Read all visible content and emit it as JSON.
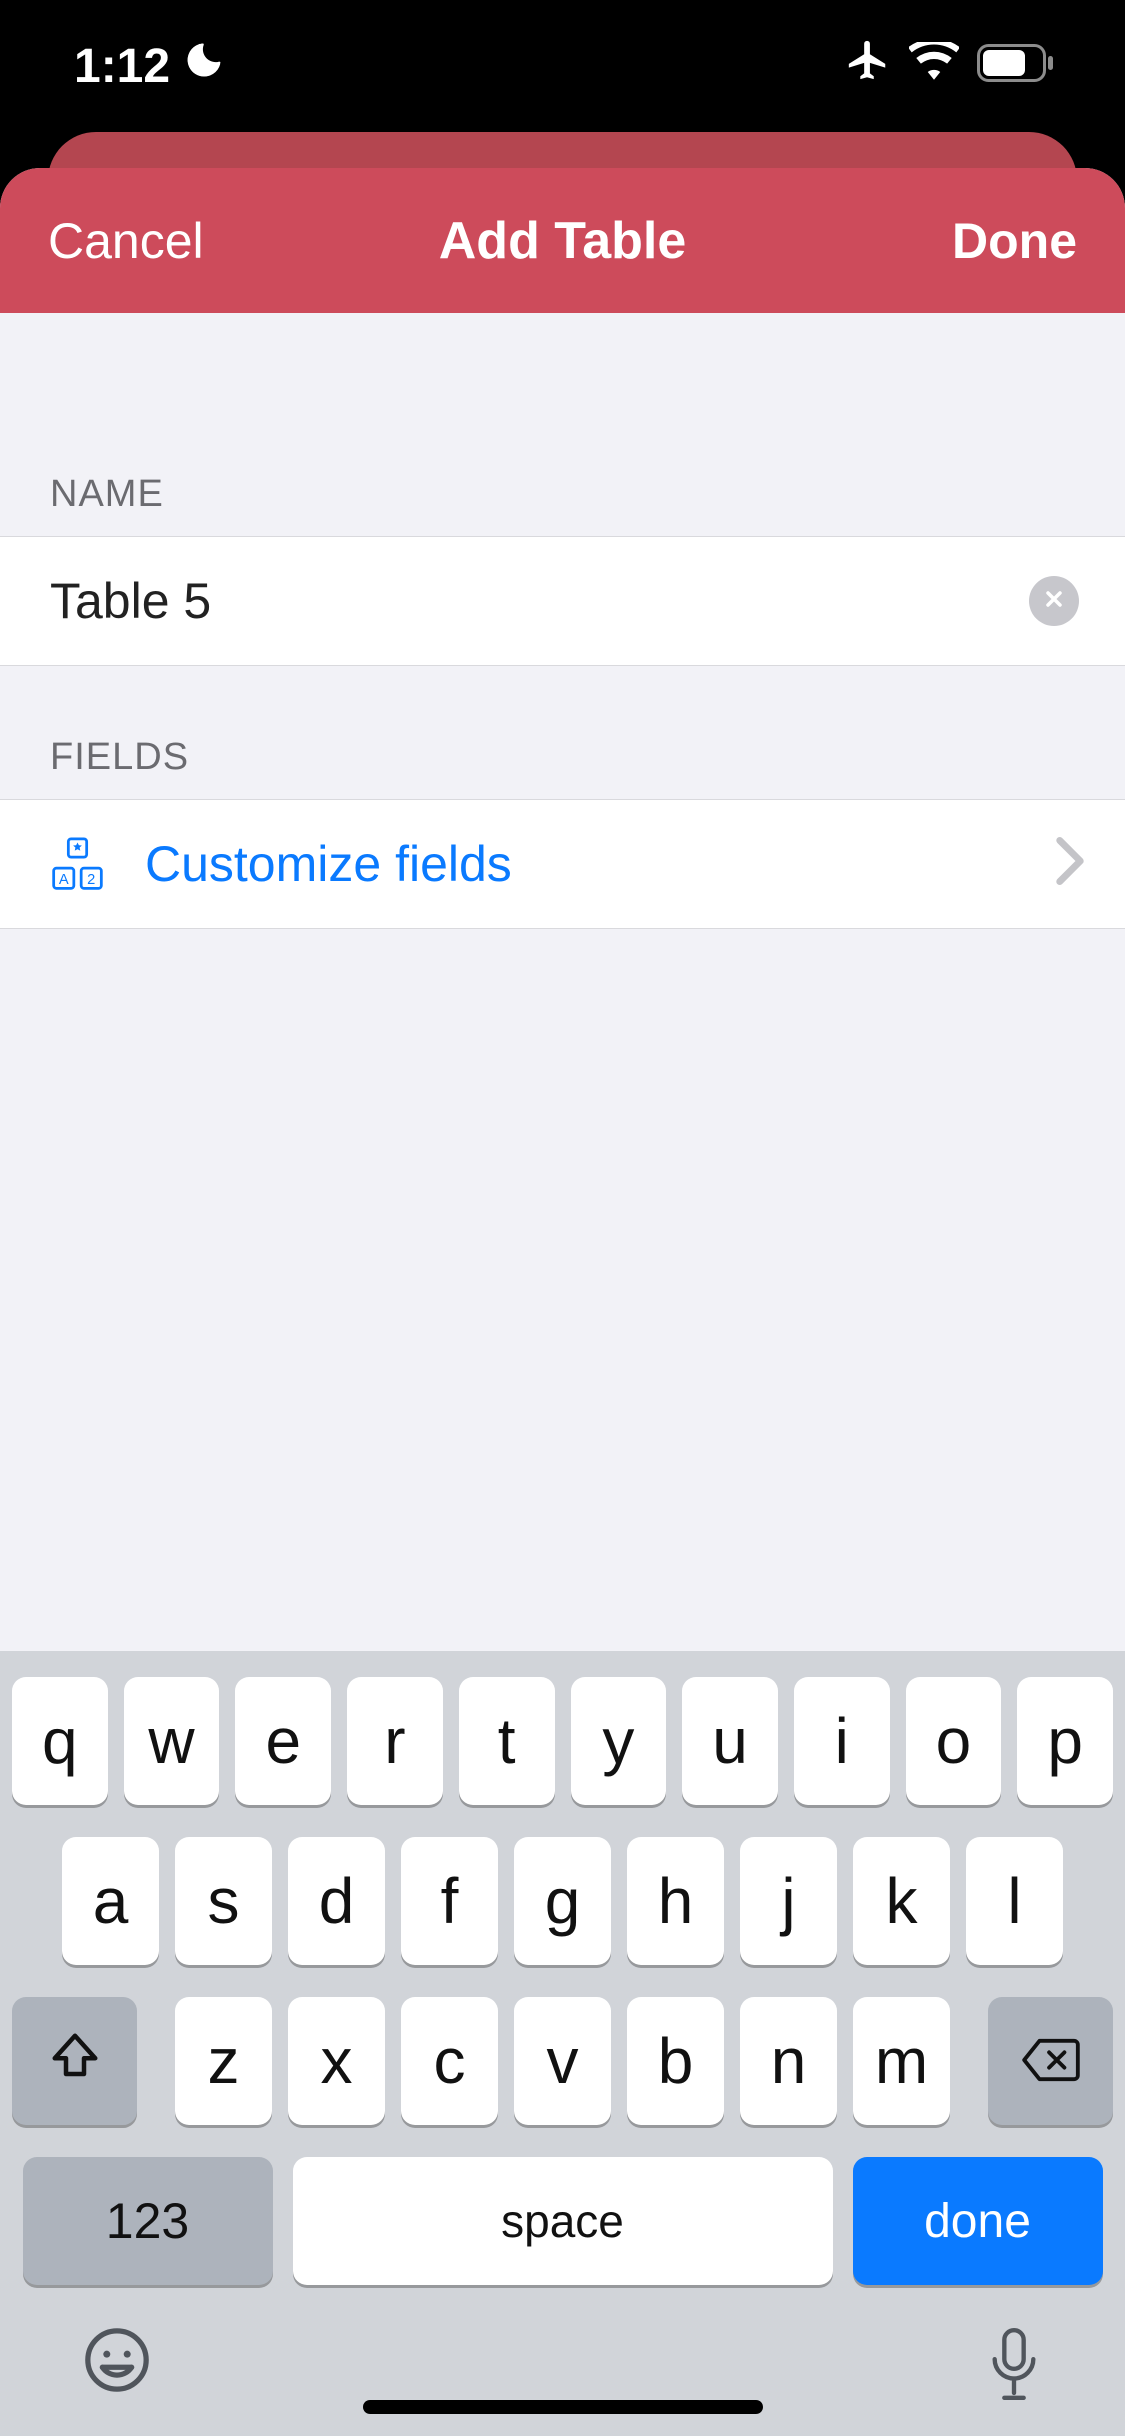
{
  "status": {
    "time": "1:12"
  },
  "header": {
    "cancel": "Cancel",
    "title": "Add Table",
    "done": "Done"
  },
  "sections": {
    "name_label": "NAME",
    "fields_label": "FIELDS",
    "name_value": "Table 5",
    "customize_label": "Customize fields"
  },
  "keyboard": {
    "row1": [
      "q",
      "w",
      "e",
      "r",
      "t",
      "y",
      "u",
      "i",
      "o",
      "p"
    ],
    "row2": [
      "a",
      "s",
      "d",
      "f",
      "g",
      "h",
      "j",
      "k",
      "l"
    ],
    "row3": [
      "z",
      "x",
      "c",
      "v",
      "b",
      "n",
      "m"
    ],
    "num": "123",
    "space": "space",
    "done": "done"
  },
  "colors": {
    "accent": "#cd4b5b",
    "link": "#0a7aff"
  }
}
